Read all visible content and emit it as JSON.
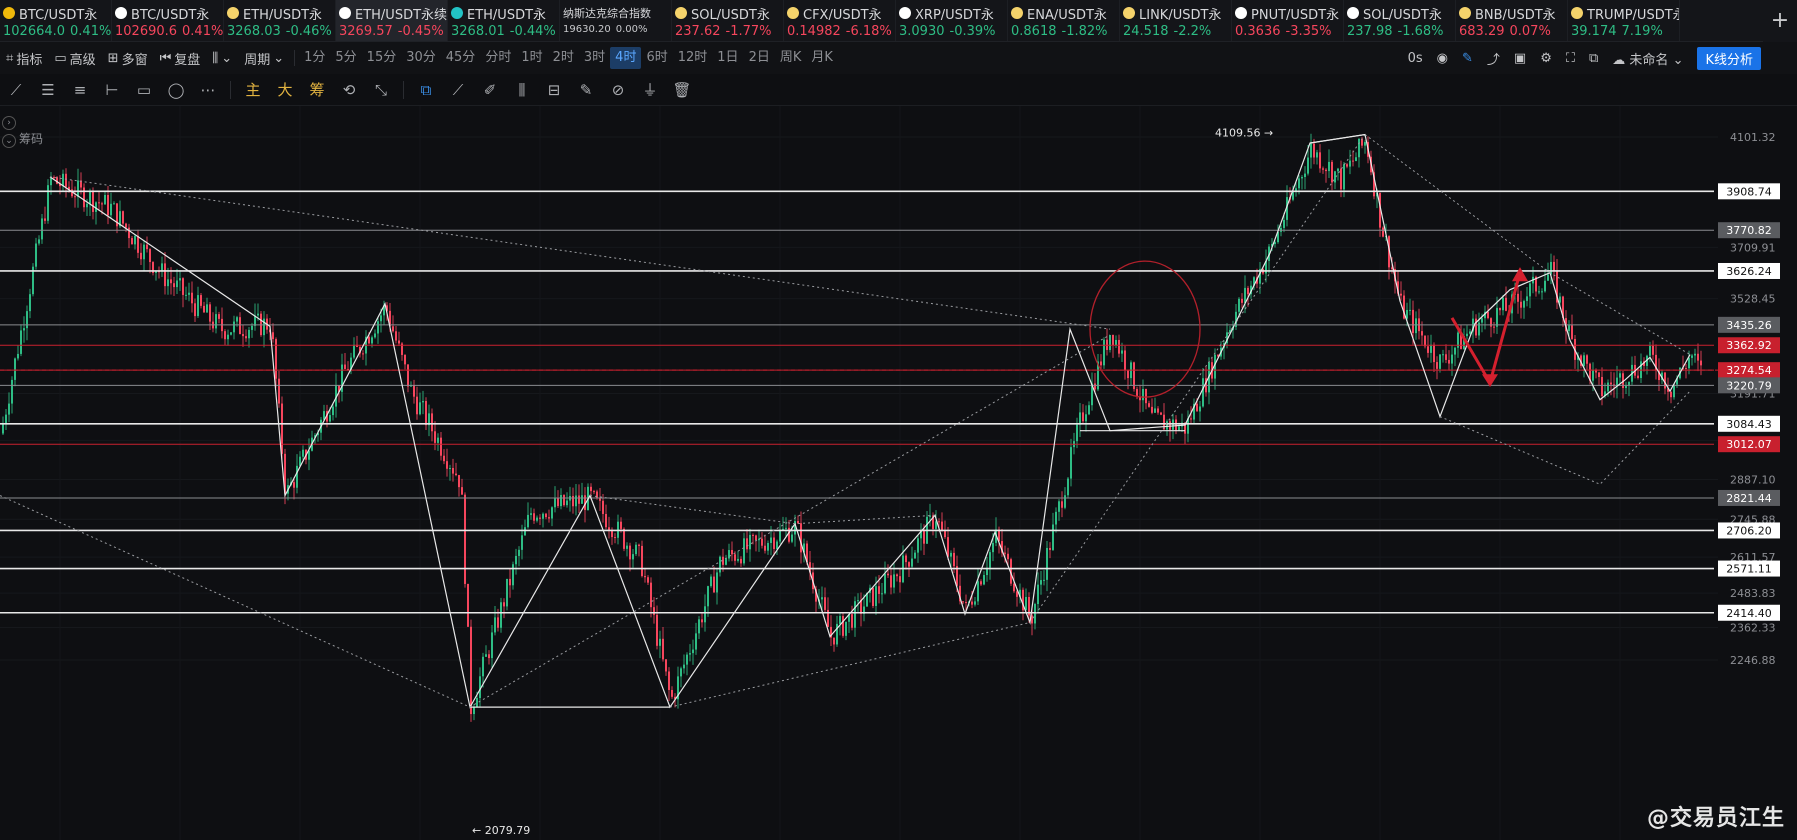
{
  "ticker": [
    {
      "name": "BTC/USDT永",
      "price": "102664.0",
      "change": "0.41%",
      "dir": "up",
      "icon": "binance",
      "iconColor": "#f0b90b"
    },
    {
      "name": "BTC/USDT永",
      "price": "102690.6",
      "change": "0.41%",
      "dir": "dn",
      "icon": "x-exchange",
      "iconColor": "#ffffff"
    },
    {
      "name": "ETH/USDT永",
      "price": "3268.03",
      "change": "-0.46%",
      "dir": "up",
      "icon": "bitget",
      "iconColor": "#f5d36b"
    },
    {
      "name": "ETH/USDT永续",
      "price": "3269.57",
      "change": "-0.45%",
      "dir": "dn",
      "icon": "okx",
      "iconColor": "#ffffff",
      "active": true
    },
    {
      "name": "ETH/USDT永",
      "price": "3268.01",
      "change": "-0.44%",
      "dir": "up",
      "icon": "bitget-s",
      "iconColor": "#22c3c5"
    },
    {
      "name": "纳斯达克综合指数",
      "price": "19630.20",
      "change": "0.00%",
      "dir": "neutral",
      "icon": "",
      "iconColor": ""
    },
    {
      "name": "SOL/USDT永",
      "price": "237.62",
      "change": "-1.77%",
      "dir": "dn",
      "icon": "bitget",
      "iconColor": "#f5d36b"
    },
    {
      "name": "CFX/USDT永",
      "price": "0.14982",
      "change": "-6.18%",
      "dir": "dn",
      "icon": "bitget",
      "iconColor": "#f5d36b"
    },
    {
      "name": "XRP/USDT永",
      "price": "3.0930",
      "change": "-0.39%",
      "dir": "up",
      "icon": "x-exchange",
      "iconColor": "#ffffff"
    },
    {
      "name": "ENA/USDT永",
      "price": "0.8618",
      "change": "-1.82%",
      "dir": "up",
      "icon": "bitget",
      "iconColor": "#f5d36b"
    },
    {
      "name": "LINK/USDT永",
      "price": "24.518",
      "change": "-2.2%",
      "dir": "up",
      "icon": "bitget",
      "iconColor": "#f5d36b"
    },
    {
      "name": "PNUT/USDT永",
      "price": "0.3636",
      "change": "-3.35%",
      "dir": "dn",
      "icon": "x-exchange",
      "iconColor": "#ffffff"
    },
    {
      "name": "SOL/USDT永",
      "price": "237.98",
      "change": "-1.68%",
      "dir": "up",
      "icon": "x-exchange",
      "iconColor": "#ffffff"
    },
    {
      "name": "BNB/USDT永",
      "price": "683.29",
      "change": "0.07%",
      "dir": "dn",
      "icon": "bitget",
      "iconColor": "#f5d36b"
    },
    {
      "name": "TRUMP/USDT永",
      "price": "39.174",
      "change": "7.19%",
      "dir": "up",
      "icon": "bitget",
      "iconColor": "#f5d36b"
    }
  ],
  "toolbar": {
    "indicators": "指标",
    "advanced": "高级",
    "multi": "多窗",
    "replay": "复盘",
    "period": "周期",
    "intervals": [
      "1分",
      "5分",
      "15分",
      "30分",
      "45分",
      "分时",
      "1时",
      "2时",
      "3时",
      "4时",
      "6时",
      "12时",
      "1日",
      "2日",
      "周K",
      "月K"
    ],
    "selected_interval": "4时",
    "countdown": "0s",
    "layout_name": "未命名",
    "kline_analysis": "K线分析"
  },
  "drawing_tools": {
    "main_label": "主",
    "large_label": "大",
    "chips_label": "筹"
  },
  "chart": {
    "chouma_label": "筹码",
    "watermark": "@交易员江生",
    "high_label": "4109.56",
    "low_label": "2079.79",
    "axis_ticks": [
      4101.32,
      3709.91,
      3528.45,
      3191.71,
      3025.5,
      2887.1,
      2745.88,
      2611.57,
      2483.83,
      2362.33,
      2246.88
    ],
    "price_levels": [
      {
        "value": "3908.74",
        "type": "white"
      },
      {
        "value": "3770.82",
        "type": "gray"
      },
      {
        "value": "3626.24",
        "type": "white"
      },
      {
        "value": "3435.26",
        "type": "gray"
      },
      {
        "value": "3362.92",
        "type": "red"
      },
      {
        "value": "3274.54",
        "type": "red"
      },
      {
        "value": "3220.79",
        "type": "gray"
      },
      {
        "value": "3084.43",
        "type": "white"
      },
      {
        "value": "3012.07",
        "type": "red"
      },
      {
        "value": "2821.44",
        "type": "gray"
      },
      {
        "value": "2706.20",
        "type": "white"
      },
      {
        "value": "2571.11",
        "type": "white"
      },
      {
        "value": "2414.40",
        "type": "white"
      }
    ]
  }
}
